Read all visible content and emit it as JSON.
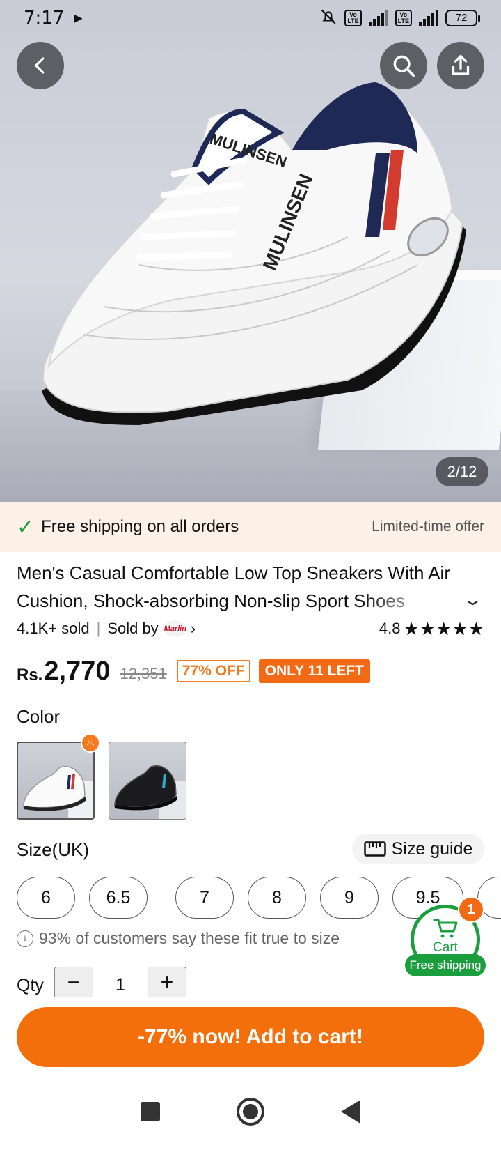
{
  "status_bar": {
    "time": "7:17",
    "battery": "72"
  },
  "gallery": {
    "counter": "2/12"
  },
  "shipping_banner": {
    "message": "Free shipping on all orders",
    "offer": "Limited-time offer"
  },
  "product": {
    "title": "Men's Casual Comfortable Low Top Sneakers With Air Cushion, Shock-absorbing Non-slip Sport Shoes",
    "sold": "4.1K+ sold",
    "sold_by_label": "Sold by",
    "brand_logo_text": "Marlin",
    "rating": "4.8",
    "price_currency": "Rs.",
    "price": "2,770",
    "original_price": "12,351",
    "discount_badge": "77% OFF",
    "stock_badge": "ONLY 11 LEFT"
  },
  "color": {
    "label": "Color",
    "options": [
      {
        "name": "white",
        "selected": true
      },
      {
        "name": "black",
        "selected": false
      }
    ]
  },
  "size": {
    "label": "Size(UK)",
    "guide_label": "Size guide",
    "options": [
      "6",
      "6.5",
      "7",
      "8",
      "9",
      "9.5"
    ],
    "fit_note": "93% of customers say these fit true to size"
  },
  "quantity": {
    "label": "Qty",
    "value": "1",
    "minus": "−",
    "plus": "+"
  },
  "cart": {
    "label": "Cart",
    "count": "1",
    "shipping_badge": "Free shipping"
  },
  "cta": {
    "label": "-77% now! Add to cart!"
  },
  "colors": {
    "accent": "#f36f0b",
    "green": "#1a9e3e",
    "banner_bg": "#fdf1e8"
  }
}
